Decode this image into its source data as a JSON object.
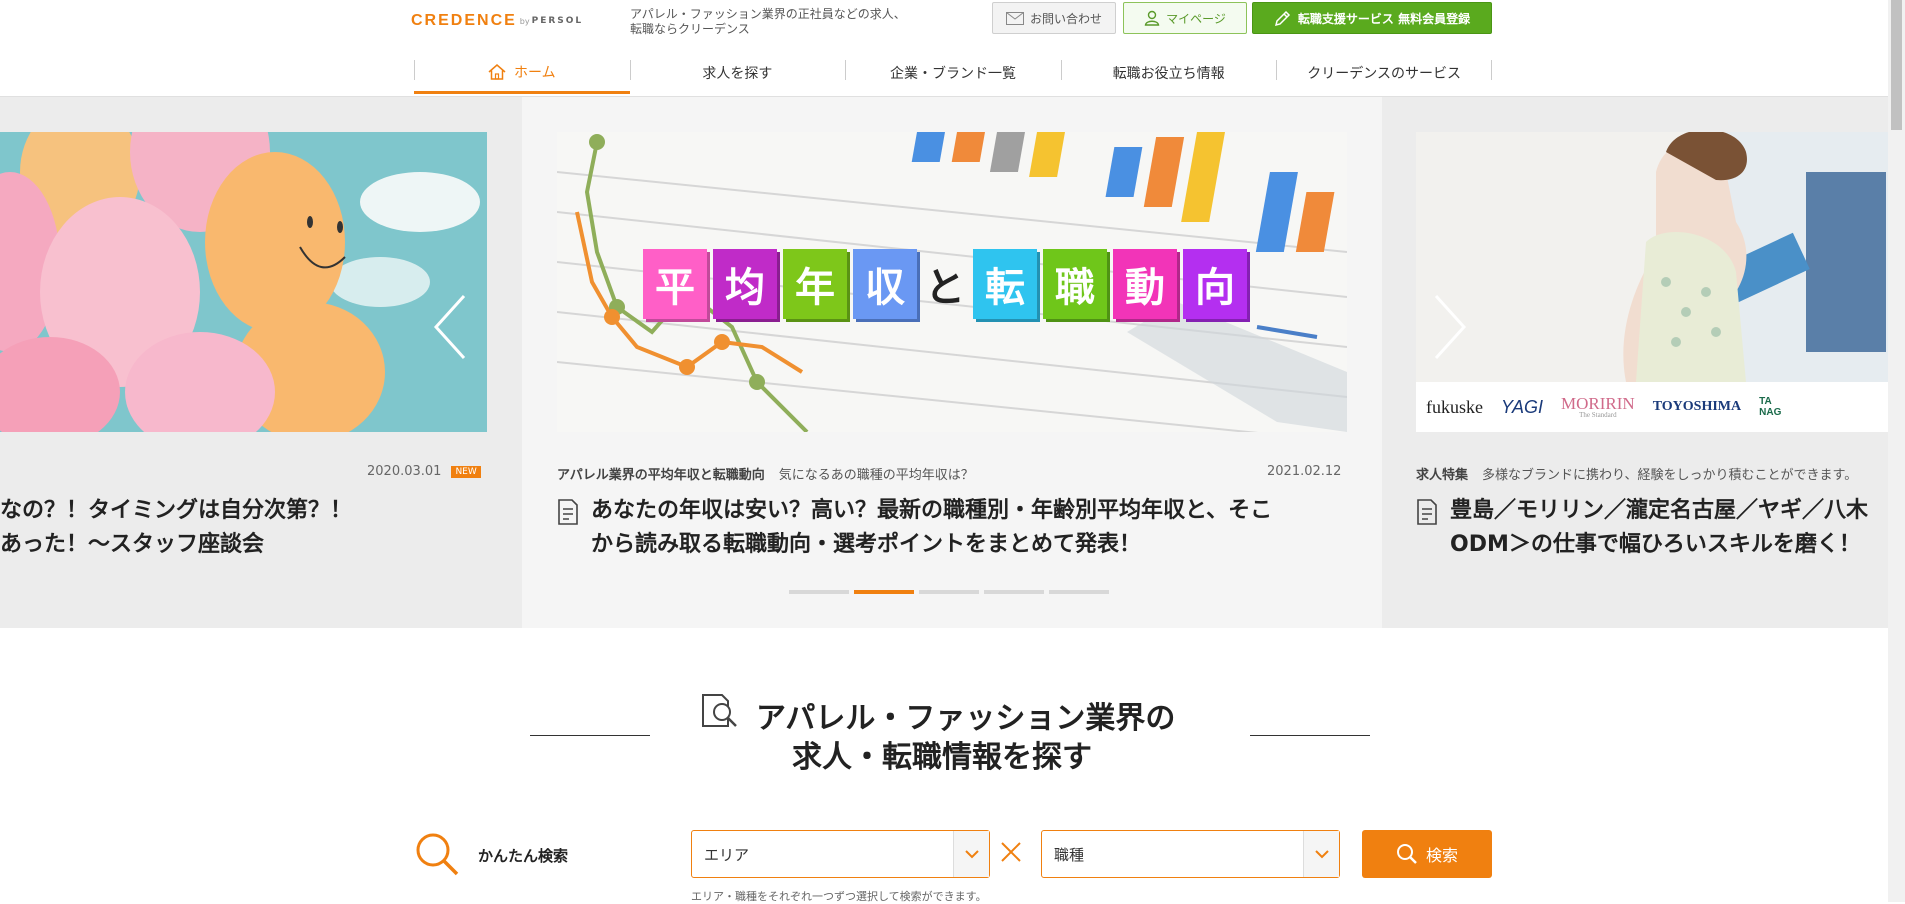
{
  "header": {
    "logo": {
      "brand": "CREDENCE",
      "by": "by",
      "persol": "PERSOL"
    },
    "tagline": "アパレル・ファッション業界の正社員などの求人、転職ならクリーデンス",
    "contact_label": "お問い合わせ",
    "mypage_label": "マイページ",
    "register_label": "転職支援サービス 無料会員登録"
  },
  "nav": {
    "items": [
      {
        "label": "ホーム"
      },
      {
        "label": "求人を探す"
      },
      {
        "label": "企業・ブランド一覧"
      },
      {
        "label": "転職お役立ち情報"
      },
      {
        "label": "クリーデンスのサービス"
      }
    ]
  },
  "carousel": {
    "left": {
      "date": "2020.03.01",
      "badge": "NEW",
      "title_line1": "なの？！タイミングは自分次第？！",
      "title_line2": "あった！～スタッフ座談会"
    },
    "center": {
      "banner_chars": [
        "平",
        "均",
        "年",
        "収",
        "と",
        "転",
        "職",
        "動",
        "向"
      ],
      "category": "アパレル業界の平均年収と転職動向",
      "subtitle": "気になるあの職種の平均年収は？",
      "date": "2021.02.12",
      "title_line1": "あなたの年収は安い？高い？最新の職種別・年齢別平均年収と、そこ",
      "title_line2": "から読み取る転職動向・選考ポイントをまとめて発表！"
    },
    "right": {
      "category": "求人特集",
      "subtitle": "多様なブランドに携わり、経験をしっかり積むことができます。",
      "logos": [
        "fukuske",
        "YAGI",
        "MORIRIN",
        "The Standard",
        "TOYOSHIMA",
        "TA",
        "NAG"
      ],
      "title_line1": "豊島／モリリン／瀧定名古屋／ヤギ／八木",
      "title_line2": "ODM＞の仕事で幅ひろいスキルを磨く！"
    },
    "dots": 5,
    "active_dot": 1
  },
  "search": {
    "heading_line1": "アパレル・ファッション業界の",
    "heading_line2": "求人・転職情報を探す",
    "easy_label": "かんたん検索",
    "area_value": "エリア",
    "job_value": "職種",
    "button_label": "検索",
    "hint": "エリア・職種をそれぞれ一つずつ選択して検索ができます。"
  },
  "colors": {
    "accent": "#f08010",
    "green": "#5aaa1e"
  }
}
